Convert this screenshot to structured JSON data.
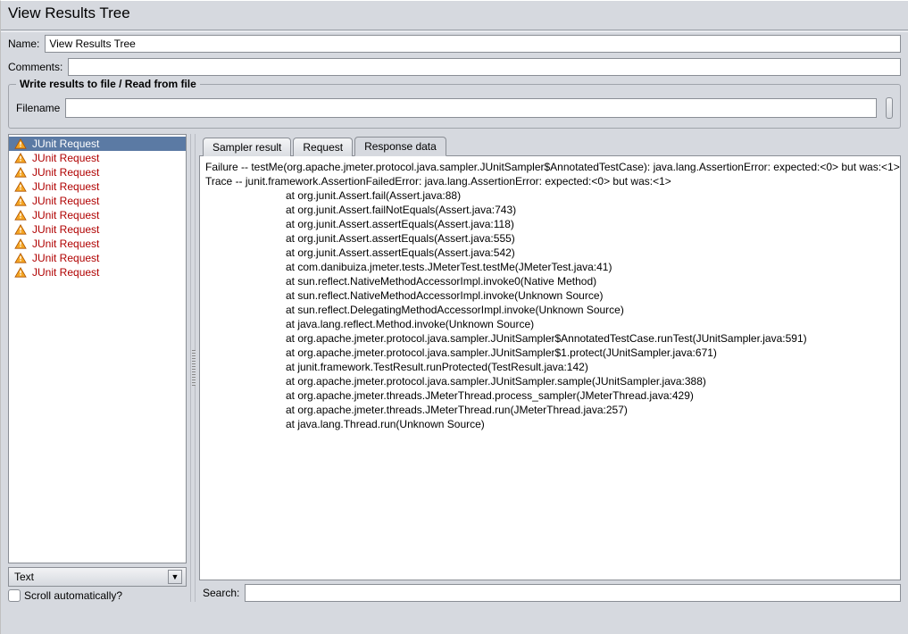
{
  "header": {
    "title": "View Results Tree"
  },
  "form": {
    "name_label": "Name:",
    "name_value": "View Results Tree",
    "comments_label": "Comments:",
    "comments_value": ""
  },
  "file_section": {
    "legend": "Write results to file / Read from file",
    "filename_label": "Filename",
    "filename_value": ""
  },
  "tree": {
    "items": [
      {
        "label": "JUnit Request",
        "selected": true
      },
      {
        "label": "JUnit Request",
        "selected": false
      },
      {
        "label": "JUnit Request",
        "selected": false
      },
      {
        "label": "JUnit Request",
        "selected": false
      },
      {
        "label": "JUnit Request",
        "selected": false
      },
      {
        "label": "JUnit Request",
        "selected": false
      },
      {
        "label": "JUnit Request",
        "selected": false
      },
      {
        "label": "JUnit Request",
        "selected": false
      },
      {
        "label": "JUnit Request",
        "selected": false
      },
      {
        "label": "JUnit Request",
        "selected": false
      }
    ]
  },
  "tabs": {
    "items": [
      {
        "label": "Sampler result",
        "active": false
      },
      {
        "label": "Request",
        "active": false
      },
      {
        "label": "Response data",
        "active": true
      }
    ]
  },
  "response": {
    "line1": "Failure -- testMe(org.apache.jmeter.protocol.java.sampler.JUnitSampler$AnnotatedTestCase): java.lang.AssertionError: expected:<0> but was:<1>",
    "line2": "Trace -- junit.framework.AssertionFailedError: java.lang.AssertionError: expected:<0> but was:<1>",
    "trace": [
      "at org.junit.Assert.fail(Assert.java:88)",
      "at org.junit.Assert.failNotEquals(Assert.java:743)",
      "at org.junit.Assert.assertEquals(Assert.java:118)",
      "at org.junit.Assert.assertEquals(Assert.java:555)",
      "at org.junit.Assert.assertEquals(Assert.java:542)",
      "at com.danibuiza.jmeter.tests.JMeterTest.testMe(JMeterTest.java:41)",
      "at sun.reflect.NativeMethodAccessorImpl.invoke0(Native Method)",
      "at sun.reflect.NativeMethodAccessorImpl.invoke(Unknown Source)",
      "at sun.reflect.DelegatingMethodAccessorImpl.invoke(Unknown Source)",
      "at java.lang.reflect.Method.invoke(Unknown Source)",
      "at org.apache.jmeter.protocol.java.sampler.JUnitSampler$AnnotatedTestCase.runTest(JUnitSampler.java:591)",
      "at org.apache.jmeter.protocol.java.sampler.JUnitSampler$1.protect(JUnitSampler.java:671)",
      "at junit.framework.TestResult.runProtected(TestResult.java:142)",
      "at org.apache.jmeter.protocol.java.sampler.JUnitSampler.sample(JUnitSampler.java:388)",
      "at org.apache.jmeter.threads.JMeterThread.process_sampler(JMeterThread.java:429)",
      "at org.apache.jmeter.threads.JMeterThread.run(JMeterThread.java:257)",
      "at java.lang.Thread.run(Unknown Source)"
    ]
  },
  "bottom": {
    "renderer_value": "Text",
    "scroll_label": "Scroll automatically?",
    "search_label": "Search:",
    "search_value": ""
  }
}
